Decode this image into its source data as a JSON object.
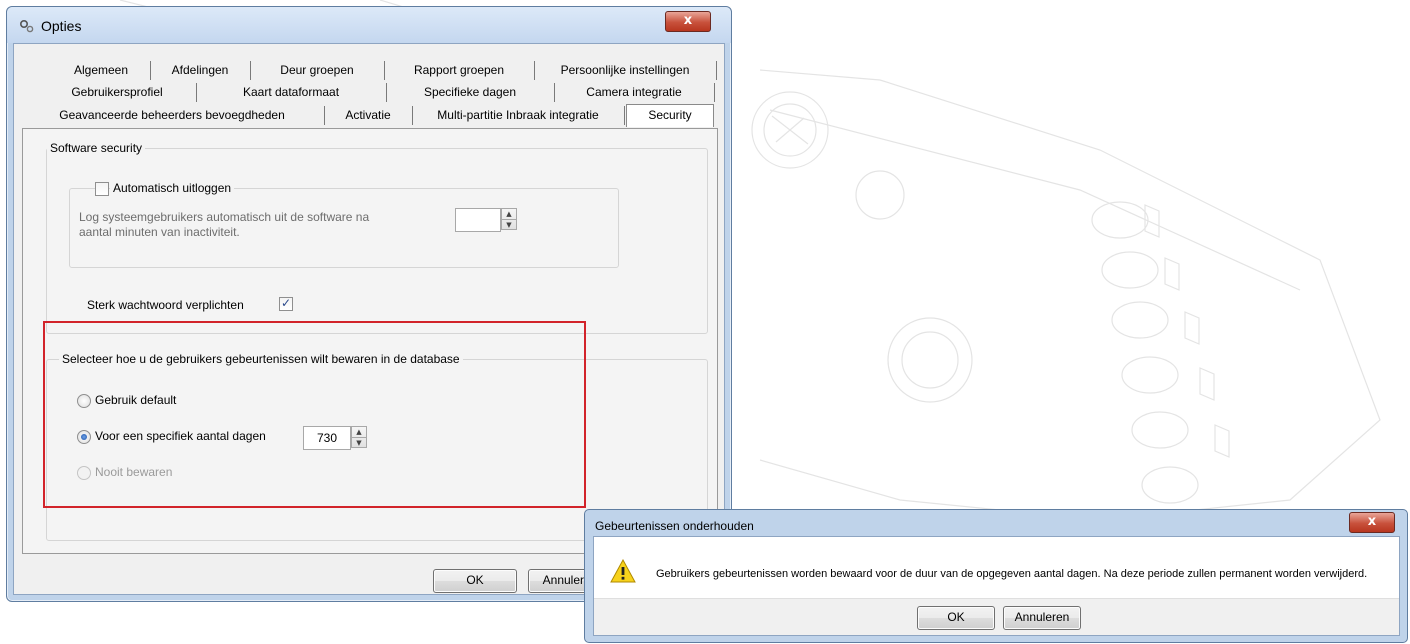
{
  "options_window": {
    "title": "Opties",
    "close_symbol": "x",
    "tabs_row1": [
      "Algemeen",
      "Afdelingen",
      "Deur groepen",
      "Rapport groepen",
      "Persoonlijke instellingen"
    ],
    "tabs_row2": [
      "Gebruikersprofiel",
      "Kaart dataformaat",
      "Specifieke dagen",
      "Camera integratie"
    ],
    "tabs_row3": [
      "Geavanceerde beheerders bevoegdheden",
      "Activatie",
      "Multi-partitie Inbraak integratie",
      "Security"
    ],
    "active_tab": "Security",
    "software_security": {
      "label": "Software security",
      "auto_logout_label": "Automatisch uitloggen",
      "auto_logout_checked": false,
      "auto_logout_description_line1": "Log systeemgebruikers automatisch uit de software  na",
      "auto_logout_description_line2": "aantal minuten van inactiviteit.",
      "auto_logout_minutes": "",
      "strong_password_label": "Sterk wachtwoord verplichten",
      "strong_password_checked": true
    },
    "events_storage": {
      "label": "Selecteer hoe u de gebruikers gebeurtenissen wilt bewaren in de database",
      "option_default": "Gebruik default",
      "option_specific": "Voor een specifiek aantal dagen",
      "option_never": "Nooit bewaren",
      "selected": "specific",
      "days": "730"
    },
    "ok_label": "OK",
    "cancel_label": "Annuleren"
  },
  "message_dialog": {
    "title": "Gebeurtenissen onderhouden",
    "close_symbol": "x",
    "icon": "warning-icon",
    "message": "Gebruikers gebeurtenissen worden bewaard voor de duur van de opgegeven aantal dagen. Na deze periode zullen permanent worden verwijderd.",
    "ok_label": "OK",
    "cancel_label": "Annuleren"
  },
  "colors": {
    "highlight_border": "#d2232a",
    "titlebar": "#c4d7ef",
    "close_button": "#c8513c"
  }
}
